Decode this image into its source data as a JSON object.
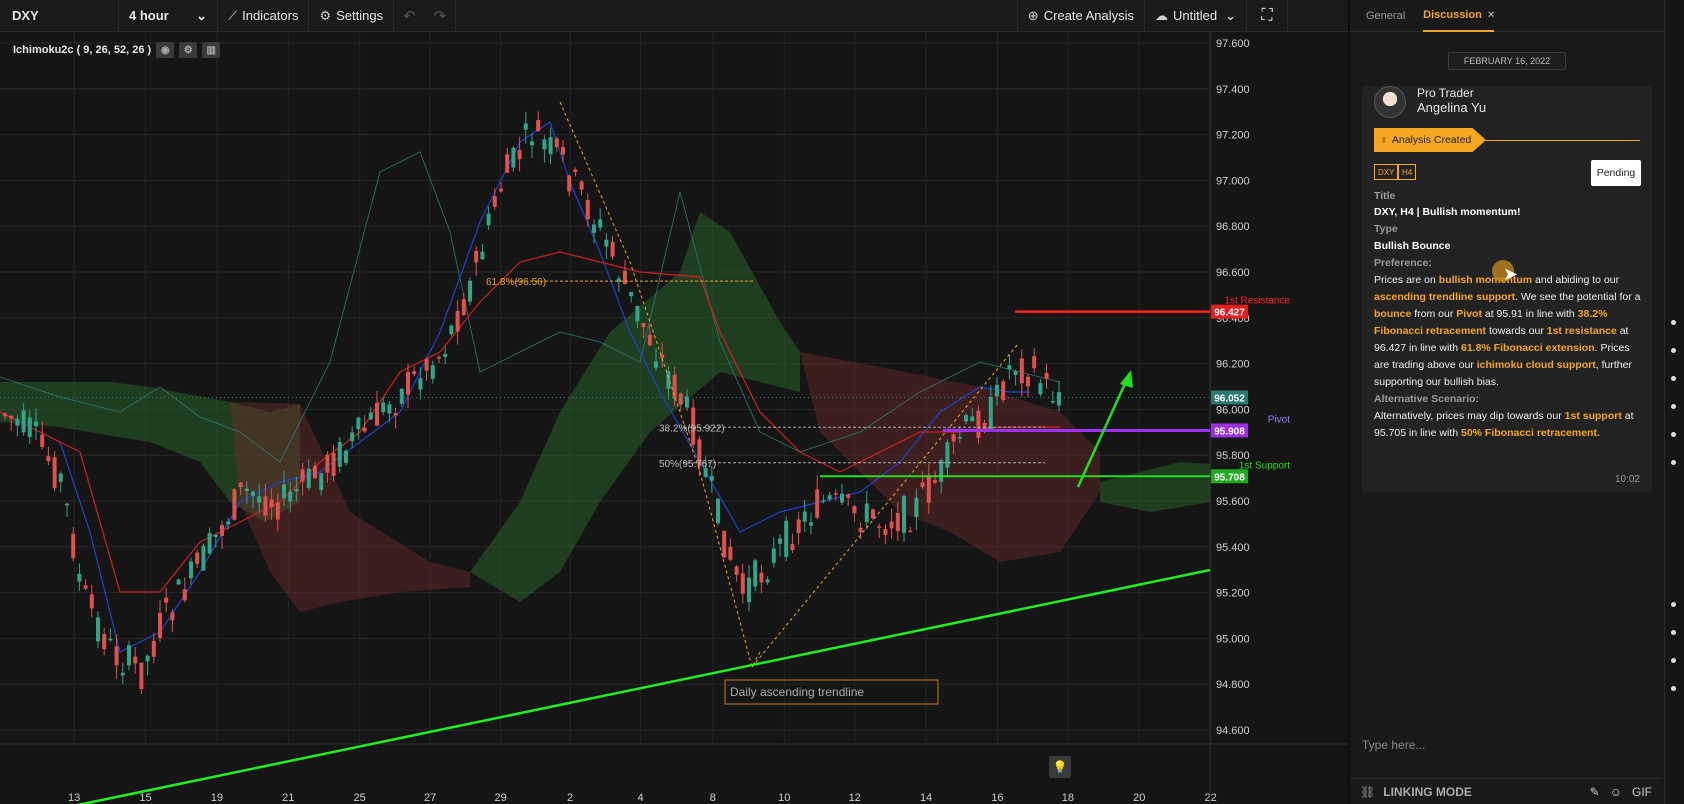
{
  "toolbar": {
    "symbol": "DXY",
    "interval": "4 hour",
    "indicators_label": "Indicators",
    "settings_label": "Settings",
    "create_analysis_label": "Create Analysis",
    "layout_name": "Untitled"
  },
  "chart": {
    "indicator_legend": "Ichimoku2c ( 9, 26, 52, 26 )",
    "price_axis": [
      "97.600",
      "97.400",
      "97.200",
      "97.000",
      "96.800",
      "96.600",
      "96.400",
      "96.200",
      "96.000",
      "95.800",
      "95.600",
      "95.400",
      "95.200",
      "95.000",
      "94.800",
      "94.600"
    ],
    "date_axis": [
      "13",
      "15",
      "19",
      "21",
      "25",
      "27",
      "29",
      "2",
      "4",
      "8",
      "10",
      "12",
      "14",
      "16",
      "18",
      "20",
      "22"
    ],
    "price_badges": {
      "resistance": "96.427",
      "current": "96.052",
      "pivot": "95.908",
      "support": "95.708"
    },
    "labels": {
      "resistance": "1st Resistance",
      "pivot": "Pivot",
      "support": "1st Support",
      "fib_618": "61.8%(96.56)",
      "fib_382": "38.2%(95.922)",
      "fib_50": "50%(95.767)",
      "trendline": "Daily ascending trendline"
    },
    "colors": {
      "resistance": "#ff2020",
      "pivot": "#a030ff",
      "support": "#22dd22",
      "trendline": "#22ee22",
      "up_candle": "#2fa58a",
      "down_candle": "#e0504f",
      "fib": "#f5a623"
    }
  },
  "panel": {
    "tabs": [
      "General",
      "Discussion"
    ],
    "date": "FEBRUARY 16, 2022",
    "author_role": "Pro Trader",
    "author_name": "Angelina Yu",
    "status_ribbon": "Analysis Created",
    "tags": [
      "DXY",
      "H4"
    ],
    "status_button": "Pending",
    "title_label": "Title",
    "title": "DXY, H4 | Bullish momentum!",
    "type_label": "Type",
    "type": "Bullish Bounce",
    "preference_label": "Preference:",
    "alt_label": "Alternative Scenario:",
    "time": "10:02",
    "input_placeholder": "Type here...",
    "linking_mode": "LINKING MODE",
    "gif": "GIF"
  }
}
